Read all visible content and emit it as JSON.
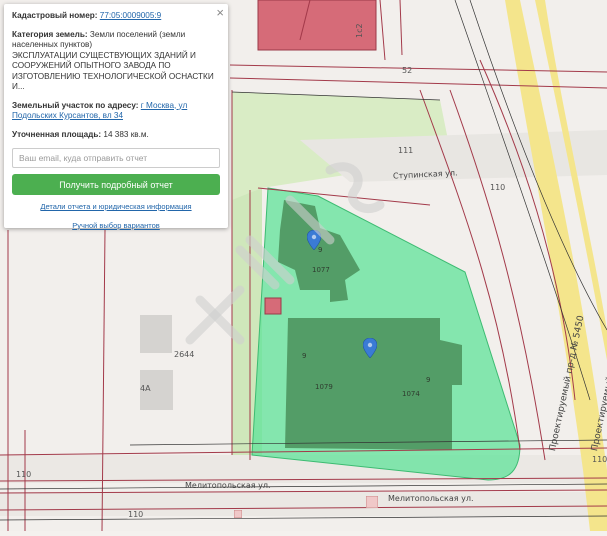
{
  "popup": {
    "cadastral_label": "Кадастровый номер:",
    "cadastral_value": "77:05:0009005:9",
    "category_label": "Категория земель:",
    "category_value": "Земли поселений (земли населенных пунктов)",
    "usage_value": "ЭКСПЛУАТАЦИИ СУЩЕСТВУЮЩИХ ЗДАНИЙ И СООРУЖЕНИЙ ОПЫТНОГО ЗАВОДА ПО ИЗГОТОВЛЕНИЮ ТЕХНОЛОГИЧЕСКОЙ ОСНАСТКИ И...",
    "address_label": "Земельный участок по адресу:",
    "address_value": "г Москва, ул Подольских Курсантов, вл 34",
    "area_label": "Уточненная площадь:",
    "area_value": "14 383 кв.м.",
    "email_placeholder": "Ваш email, куда отправить отчет",
    "report_button": "Получить подробный отчет",
    "details_link": "Детали отчета и юридическая информация",
    "manual_link": "Ручной выбор вариантов",
    "close_symbol": "×"
  },
  "map": {
    "labels": {
      "l1": "1с2",
      "l52": "52",
      "l111": "111",
      "l110a": "110",
      "l110b": "110",
      "l110c": "110",
      "l110d": "110",
      "l2644": "2644",
      "l4a": "4А",
      "l1077": "1077",
      "l1079": "1079",
      "l1074": "1074",
      "l9a": "9",
      "l9b": "9",
      "l9c": "9"
    },
    "streets": {
      "stupinskaya": "Ступинская ул.",
      "melitopolskaya1": "Мелитопольская ул.",
      "melitopolskaya2": "Мелитопольская ул.",
      "proezd1": "Проектируемый пр-д № 5450",
      "proezd2": "Проектируемый пр-д № 5450"
    },
    "colors": {
      "plot_fill": "#5fe39a",
      "building": "#4a8f5a",
      "road": "#f2e07a",
      "boundary": "#a33a4a",
      "pin": "#3a7bd5",
      "button": "#4caf50"
    }
  }
}
